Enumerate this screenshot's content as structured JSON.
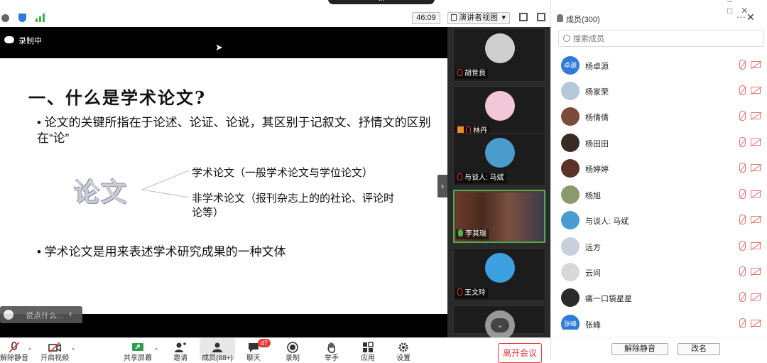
{
  "topbar": {
    "speaker_banner": "...",
    "timer": "46:09",
    "view_mode": "演讲者视图",
    "view_mode_caret": "▾"
  },
  "recording": {
    "label": "录制中"
  },
  "slide": {
    "title": "一、什么是学术论文?",
    "bullet1": "• 论文的关键所指在于论述、论证、论说，其区别于记叙文、抒情文的区别在“论”",
    "center_word": "论文",
    "branch1": "学术论文（一般学术论文与学位论文）",
    "branch2": "非学术论文（报刊杂志上的的社论、评论时论等）",
    "bullet2": "• 学术论文是用来表述学术研究成果的一种文体"
  },
  "chat_bubble": {
    "placeholder": "说点什么..."
  },
  "video_strip": {
    "tiles": [
      {
        "name": "胡世良",
        "avatar_color": "#cfcfcf"
      },
      {
        "name": "林丹",
        "avatar_color": "#f2c7d8"
      },
      {
        "name": "与谈人: 马斌",
        "avatar_color": "#4a9ccf"
      },
      {
        "name": "李其瑞",
        "avatar_color": "#6b4a3a"
      },
      {
        "name": "王文玲",
        "avatar_color": "#3da0e0"
      },
      {
        "name": "",
        "avatar_color": "#999999"
      }
    ]
  },
  "toolbar": {
    "unmute": "解除静音",
    "start_video": "开启视频",
    "share_screen": "共享屏幕",
    "invite": "邀请",
    "members": "成员(88+)",
    "chat": "聊天",
    "chat_badge": "47",
    "record": "录制",
    "raise_hand": "举手",
    "apps": "应用",
    "settings": "设置",
    "leave": "离开会议"
  },
  "panel": {
    "title": "成员(300)",
    "more_icon": "···",
    "close_icon": "✕",
    "search_placeholder": "搜索成员",
    "members": [
      {
        "name": "杨卓源",
        "avatar_text": "卓源",
        "avatar_color": "#2f7bd8"
      },
      {
        "name": "杨家荣",
        "avatar_text": "",
        "avatar_color": "#b7c8d8"
      },
      {
        "name": "杨倩倩",
        "avatar_text": "",
        "avatar_color": "#7a4b3a"
      },
      {
        "name": "杨田田",
        "avatar_text": "",
        "avatar_color": "#3a2a24"
      },
      {
        "name": "杨婷婷",
        "avatar_text": "",
        "avatar_color": "#5b3225"
      },
      {
        "name": "杨旭",
        "avatar_text": "",
        "avatar_color": "#8a9a6a"
      },
      {
        "name": "与谈人: 马斌",
        "avatar_text": "",
        "avatar_color": "#4a9ccf"
      },
      {
        "name": "远方",
        "avatar_text": "",
        "avatar_color": "#c8d0dc"
      },
      {
        "name": "云问",
        "avatar_text": "",
        "avatar_color": "#d8d8d8"
      },
      {
        "name": "痛一口袋星星",
        "avatar_text": "",
        "avatar_color": "#2a2a2a"
      },
      {
        "name": "张峰",
        "avatar_text": "张峰",
        "avatar_color": "#2f7bd8"
      }
    ],
    "mute_all": "解除静音",
    "rename": "改名"
  }
}
